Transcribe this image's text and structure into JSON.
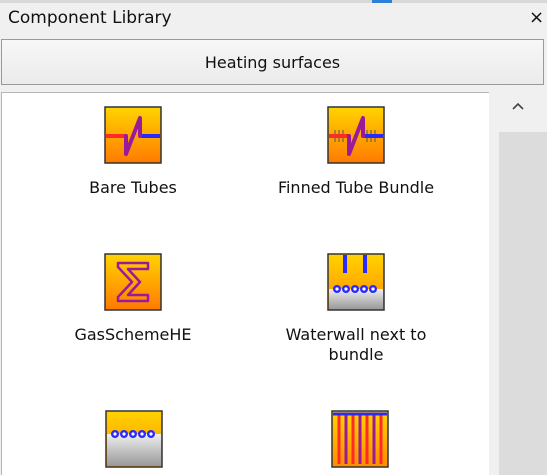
{
  "window": {
    "title": "Component Library",
    "close_glyph": "×"
  },
  "category": {
    "label": "Heating surfaces"
  },
  "items": [
    {
      "label": "Bare Tubes",
      "icon": "bare-tubes-icon"
    },
    {
      "label": "Finned Tube Bundle",
      "icon": "finned-tube-bundle-icon"
    },
    {
      "label": "GasSchemeHE",
      "icon": "gas-scheme-he-icon"
    },
    {
      "label": "Waterwall next to bundle",
      "icon": "waterwall-next-to-bundle-icon"
    },
    {
      "label": "",
      "icon": "tube-row-icon"
    },
    {
      "label": "",
      "icon": "tube-panel-icon"
    }
  ],
  "colors": {
    "icon_gradient_top": "#ffd400",
    "icon_gradient_bottom": "#ff7a00",
    "tube_red": "#ff2a2a",
    "tube_blue": "#2a2aff",
    "tube_purple": "#9a1a9a"
  }
}
